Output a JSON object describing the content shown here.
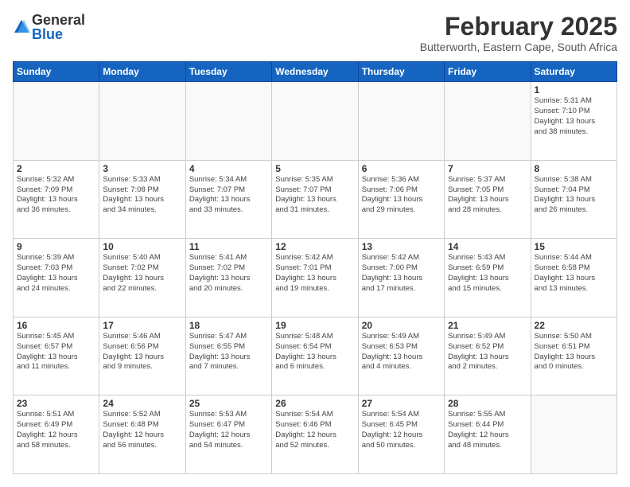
{
  "logo": {
    "general": "General",
    "blue": "Blue"
  },
  "header": {
    "title": "February 2025",
    "subtitle": "Butterworth, Eastern Cape, South Africa"
  },
  "weekdays": [
    "Sunday",
    "Monday",
    "Tuesday",
    "Wednesday",
    "Thursday",
    "Friday",
    "Saturday"
  ],
  "weeks": [
    [
      {
        "day": "",
        "info": ""
      },
      {
        "day": "",
        "info": ""
      },
      {
        "day": "",
        "info": ""
      },
      {
        "day": "",
        "info": ""
      },
      {
        "day": "",
        "info": ""
      },
      {
        "day": "",
        "info": ""
      },
      {
        "day": "1",
        "info": "Sunrise: 5:31 AM\nSunset: 7:10 PM\nDaylight: 13 hours\nand 38 minutes."
      }
    ],
    [
      {
        "day": "2",
        "info": "Sunrise: 5:32 AM\nSunset: 7:09 PM\nDaylight: 13 hours\nand 36 minutes."
      },
      {
        "day": "3",
        "info": "Sunrise: 5:33 AM\nSunset: 7:08 PM\nDaylight: 13 hours\nand 34 minutes."
      },
      {
        "day": "4",
        "info": "Sunrise: 5:34 AM\nSunset: 7:07 PM\nDaylight: 13 hours\nand 33 minutes."
      },
      {
        "day": "5",
        "info": "Sunrise: 5:35 AM\nSunset: 7:07 PM\nDaylight: 13 hours\nand 31 minutes."
      },
      {
        "day": "6",
        "info": "Sunrise: 5:36 AM\nSunset: 7:06 PM\nDaylight: 13 hours\nand 29 minutes."
      },
      {
        "day": "7",
        "info": "Sunrise: 5:37 AM\nSunset: 7:05 PM\nDaylight: 13 hours\nand 28 minutes."
      },
      {
        "day": "8",
        "info": "Sunrise: 5:38 AM\nSunset: 7:04 PM\nDaylight: 13 hours\nand 26 minutes."
      }
    ],
    [
      {
        "day": "9",
        "info": "Sunrise: 5:39 AM\nSunset: 7:03 PM\nDaylight: 13 hours\nand 24 minutes."
      },
      {
        "day": "10",
        "info": "Sunrise: 5:40 AM\nSunset: 7:02 PM\nDaylight: 13 hours\nand 22 minutes."
      },
      {
        "day": "11",
        "info": "Sunrise: 5:41 AM\nSunset: 7:02 PM\nDaylight: 13 hours\nand 20 minutes."
      },
      {
        "day": "12",
        "info": "Sunrise: 5:42 AM\nSunset: 7:01 PM\nDaylight: 13 hours\nand 19 minutes."
      },
      {
        "day": "13",
        "info": "Sunrise: 5:42 AM\nSunset: 7:00 PM\nDaylight: 13 hours\nand 17 minutes."
      },
      {
        "day": "14",
        "info": "Sunrise: 5:43 AM\nSunset: 6:59 PM\nDaylight: 13 hours\nand 15 minutes."
      },
      {
        "day": "15",
        "info": "Sunrise: 5:44 AM\nSunset: 6:58 PM\nDaylight: 13 hours\nand 13 minutes."
      }
    ],
    [
      {
        "day": "16",
        "info": "Sunrise: 5:45 AM\nSunset: 6:57 PM\nDaylight: 13 hours\nand 11 minutes."
      },
      {
        "day": "17",
        "info": "Sunrise: 5:46 AM\nSunset: 6:56 PM\nDaylight: 13 hours\nand 9 minutes."
      },
      {
        "day": "18",
        "info": "Sunrise: 5:47 AM\nSunset: 6:55 PM\nDaylight: 13 hours\nand 7 minutes."
      },
      {
        "day": "19",
        "info": "Sunrise: 5:48 AM\nSunset: 6:54 PM\nDaylight: 13 hours\nand 6 minutes."
      },
      {
        "day": "20",
        "info": "Sunrise: 5:49 AM\nSunset: 6:53 PM\nDaylight: 13 hours\nand 4 minutes."
      },
      {
        "day": "21",
        "info": "Sunrise: 5:49 AM\nSunset: 6:52 PM\nDaylight: 13 hours\nand 2 minutes."
      },
      {
        "day": "22",
        "info": "Sunrise: 5:50 AM\nSunset: 6:51 PM\nDaylight: 13 hours\nand 0 minutes."
      }
    ],
    [
      {
        "day": "23",
        "info": "Sunrise: 5:51 AM\nSunset: 6:49 PM\nDaylight: 12 hours\nand 58 minutes."
      },
      {
        "day": "24",
        "info": "Sunrise: 5:52 AM\nSunset: 6:48 PM\nDaylight: 12 hours\nand 56 minutes."
      },
      {
        "day": "25",
        "info": "Sunrise: 5:53 AM\nSunset: 6:47 PM\nDaylight: 12 hours\nand 54 minutes."
      },
      {
        "day": "26",
        "info": "Sunrise: 5:54 AM\nSunset: 6:46 PM\nDaylight: 12 hours\nand 52 minutes."
      },
      {
        "day": "27",
        "info": "Sunrise: 5:54 AM\nSunset: 6:45 PM\nDaylight: 12 hours\nand 50 minutes."
      },
      {
        "day": "28",
        "info": "Sunrise: 5:55 AM\nSunset: 6:44 PM\nDaylight: 12 hours\nand 48 minutes."
      },
      {
        "day": "",
        "info": ""
      }
    ]
  ]
}
